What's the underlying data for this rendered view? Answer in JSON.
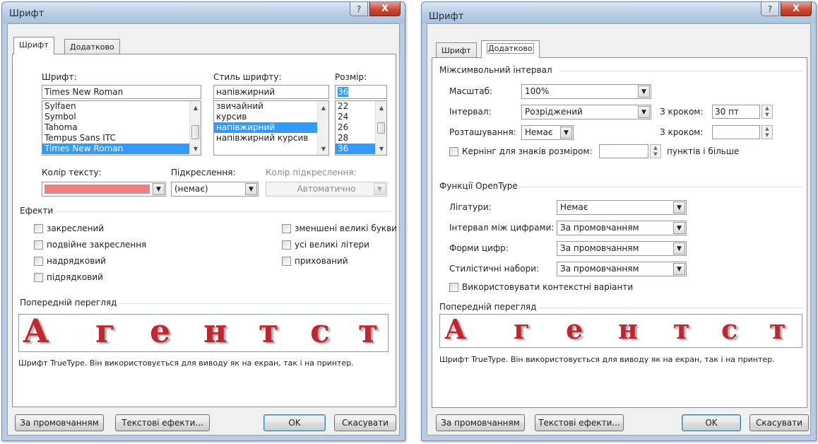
{
  "left": {
    "title": "Шрифт",
    "help_glyph": "?",
    "close_glyph": "X",
    "tabs": [
      "Шрифт",
      "Додатково"
    ],
    "font_label": "Шрифт:",
    "style_label": "Стиль шрифту:",
    "size_label": "Розмір:",
    "font_value": "Times New Roman",
    "style_value": "напівжирний",
    "size_value": "36",
    "fonts": [
      "Sylfaen",
      "Symbol",
      "Tahoma",
      "Tempus Sans ITC",
      "Times New Roman"
    ],
    "styles": [
      "звичайний",
      "курсив",
      "напівжирний",
      "напівжирний курсив"
    ],
    "sizes": [
      "22",
      "24",
      "26",
      "28",
      "36"
    ],
    "text_color_label": "Колір тексту:",
    "text_color": "#f08080",
    "underline_label": "Підкреслення:",
    "underline_value": "(немає)",
    "underline_color_label": "Колір підкреслення:",
    "underline_color_value": "Автоматично",
    "effects_title": "Ефекти",
    "effects_left": [
      "закреслений",
      "подвійне закреслення",
      "надрядковий",
      "підрядковий"
    ],
    "effects_right": [
      "зменшені великі букви",
      "усі великі літери",
      "прихований"
    ],
    "preview_title": "Попередній перегляд",
    "preview_letters": [
      "А",
      "г",
      "е",
      "н",
      "т",
      "с",
      "т"
    ],
    "preview_note": "Шрифт TrueType. Він використовується для виводу як на екран, так і на принтер.",
    "buttons": {
      "default": "За промовчанням",
      "effects": "Текстові ефекти...",
      "ok": "OK",
      "cancel": "Скасувати"
    }
  },
  "right": {
    "title": "Шрифт",
    "help_glyph": "?",
    "close_glyph": "X",
    "tabs": [
      "Шрифт",
      "Додатково"
    ],
    "spacing_title": "Міжсимвольний інтервал",
    "scale_label": "Масштаб:",
    "scale_value": "100%",
    "spacing_label": "Інтервал:",
    "spacing_value": "Розріджений",
    "by_label_1": "З кроком:",
    "by_value_1": "30 пт",
    "position_label": "Розташування:",
    "position_value": "Немає",
    "by_label_2": "З кроком:",
    "kerning_label": "Кернінг для знаків розміром:",
    "kerning_suffix": "пунктів і більше",
    "opentype_title": "Функції OpenType",
    "ligatures_label": "Лігатури:",
    "ligatures_value": "Немає",
    "num_spacing_label": "Інтервал між цифрами:",
    "num_spacing_value": "За промовчанням",
    "num_forms_label": "Форми цифр:",
    "num_forms_value": "За промовчанням",
    "stylistic_label": "Стилістичні набори:",
    "stylistic_value": "За промовчанням",
    "contextual_label": "Використовувати контекстні варіанти",
    "preview_title": "Попередній перегляд",
    "preview_letters": [
      "А",
      "г",
      "е",
      "н",
      "т",
      "с",
      "т"
    ],
    "preview_note": "Шрифт TrueType. Він використовується для виводу як на екран, так і на принтер.",
    "buttons": {
      "default": "За промовчанням",
      "effects": "Текстові ефекти...",
      "ok": "OK",
      "cancel": "Скасувати"
    }
  }
}
